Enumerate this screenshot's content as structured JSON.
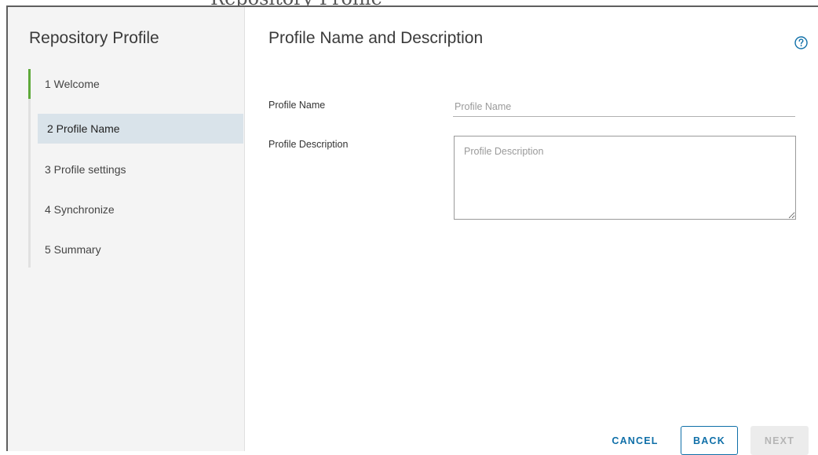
{
  "background": {
    "title": "Repository Profile"
  },
  "sidebar": {
    "title": "Repository Profile",
    "steps": [
      {
        "label": "1 Welcome",
        "state": "completed"
      },
      {
        "label": "2 Profile Name",
        "state": "active"
      },
      {
        "label": "3 Profile settings",
        "state": "pending"
      },
      {
        "label": "4 Synchronize",
        "state": "pending"
      },
      {
        "label": "5 Summary",
        "state": "pending"
      }
    ]
  },
  "main": {
    "title": "Profile Name and Description",
    "help_icon": "help-circle-icon",
    "fields": {
      "name": {
        "label": "Profile Name",
        "placeholder": "Profile Name",
        "value": ""
      },
      "description": {
        "label": "Profile Description",
        "placeholder": "Profile Description",
        "value": ""
      }
    }
  },
  "footer": {
    "cancel_label": "CANCEL",
    "back_label": "BACK",
    "next_label": "NEXT"
  },
  "colors": {
    "accent": "#0f6fa8",
    "completed_step": "#5ea93a",
    "active_step_bg": "#d9e3ea",
    "sidebar_bg": "#f4f4f4"
  }
}
